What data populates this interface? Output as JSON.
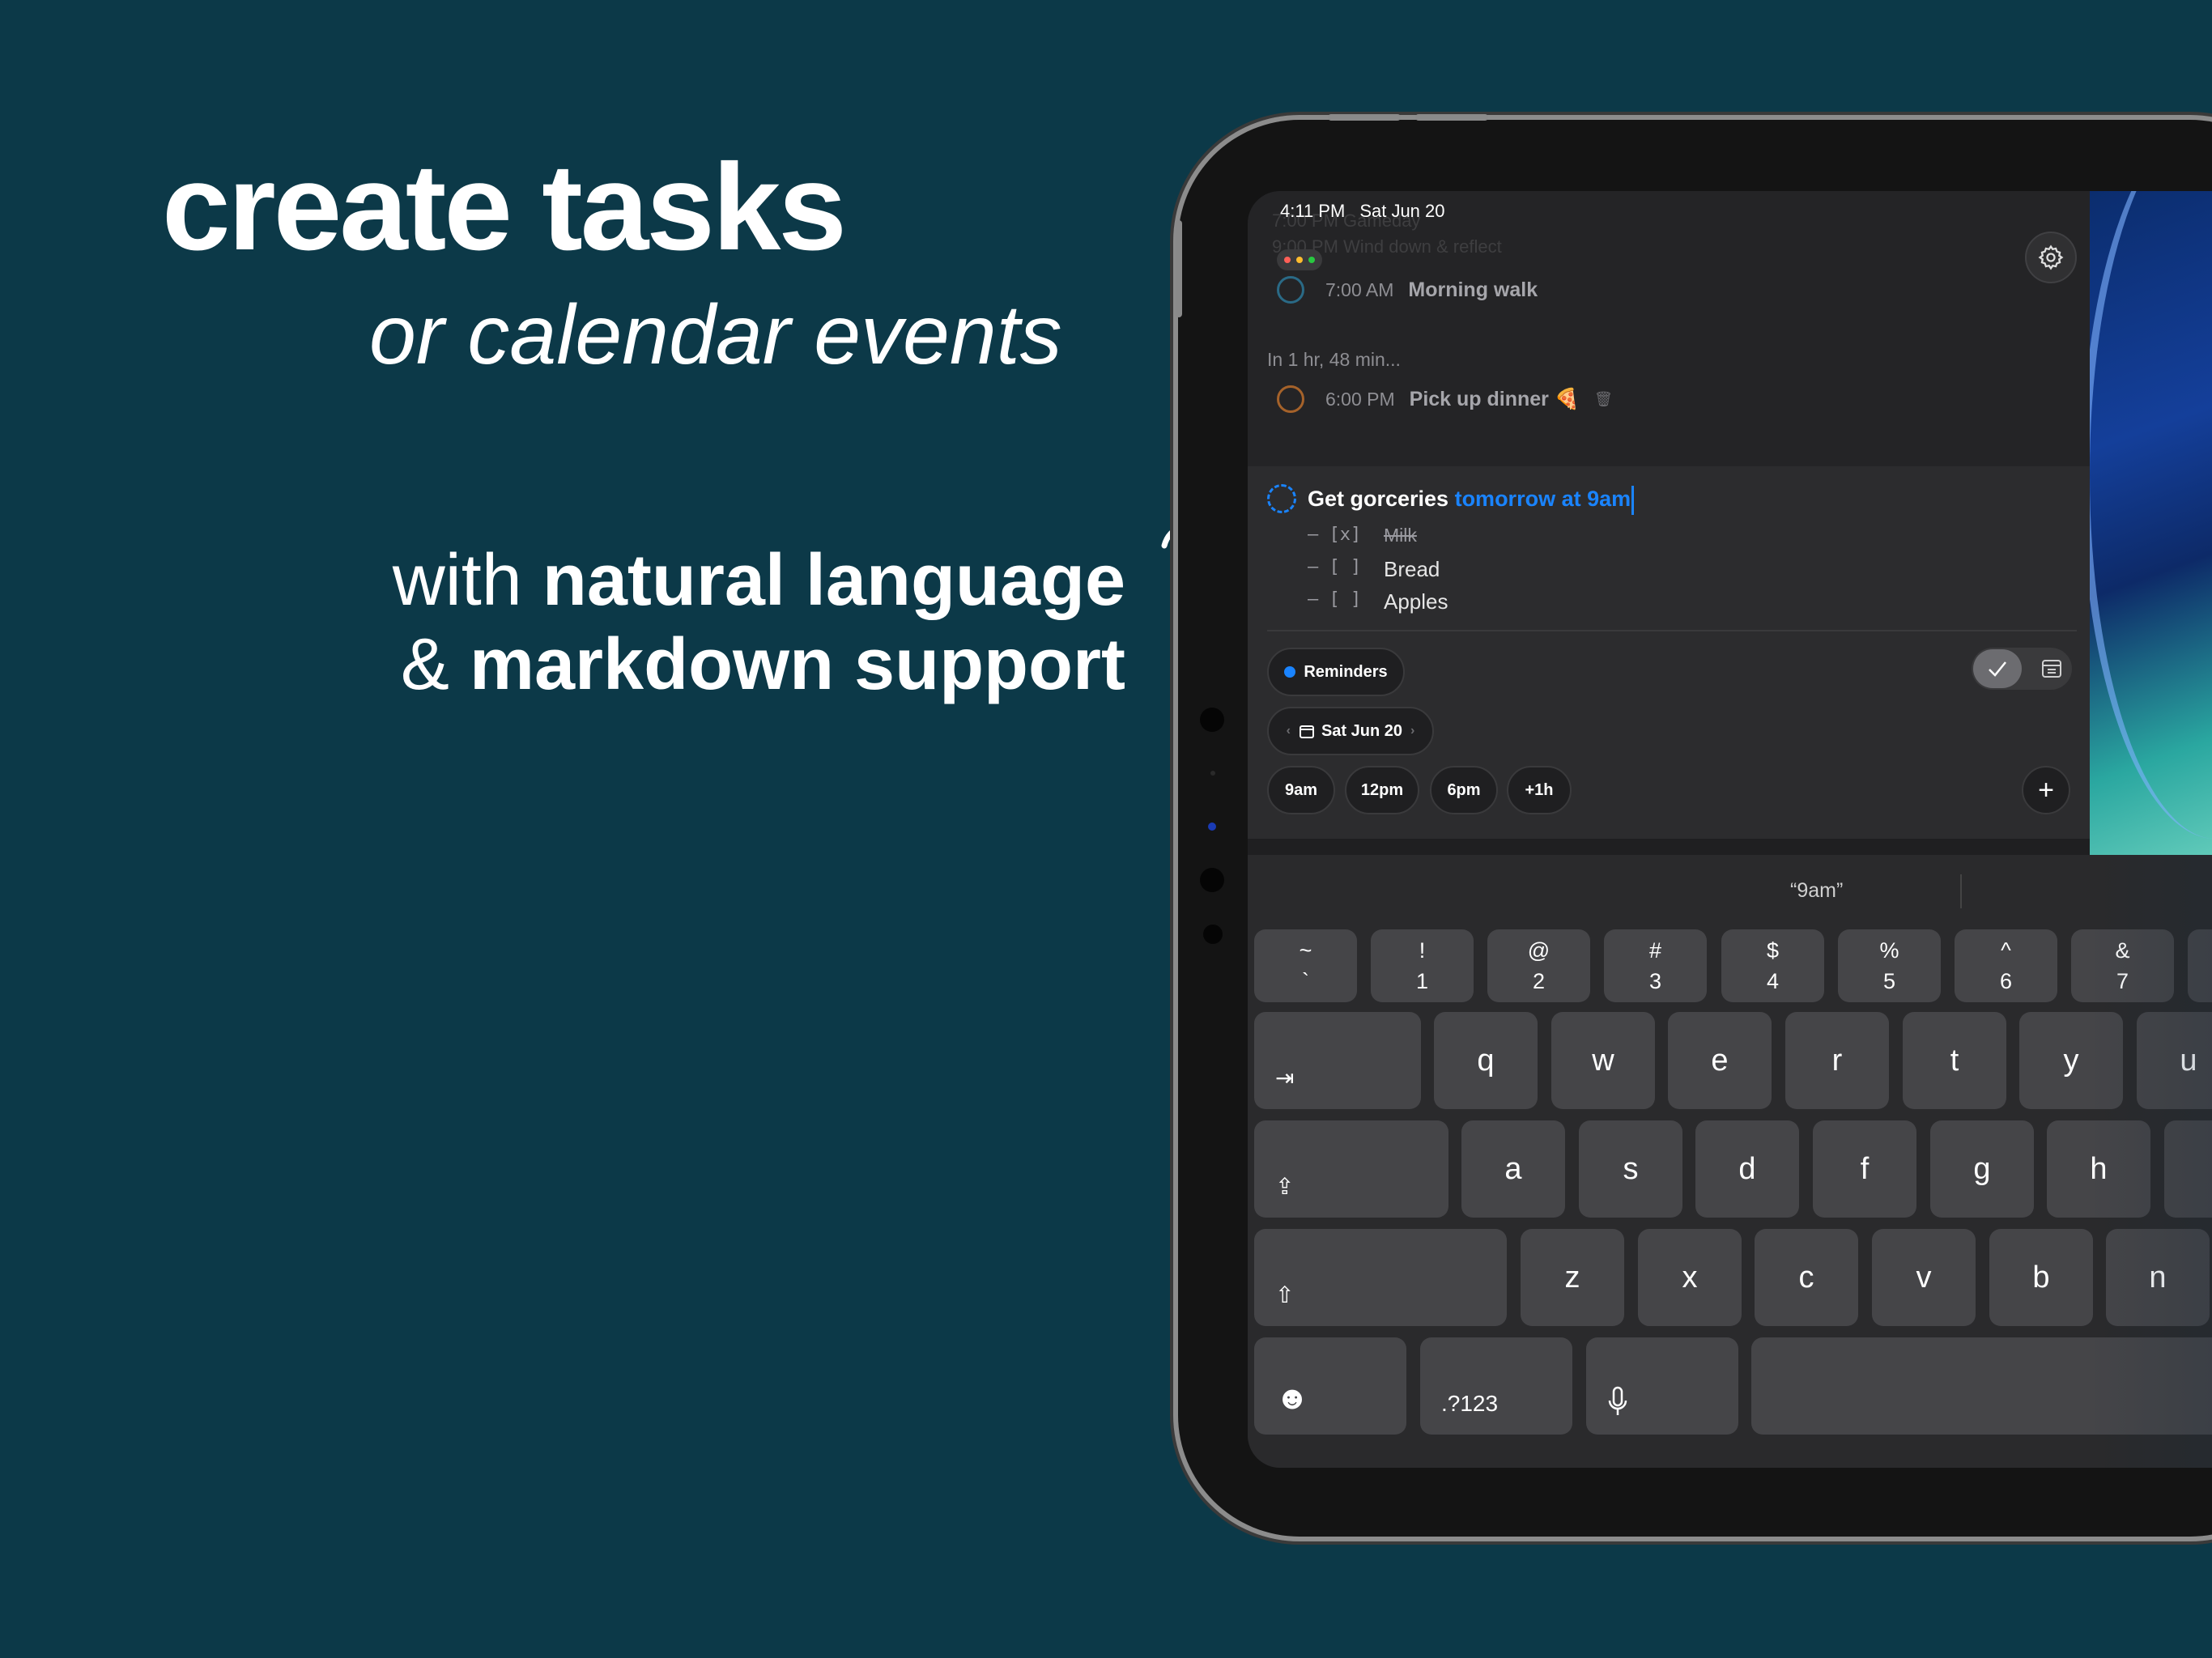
{
  "hero": {
    "headline": "create tasks",
    "subheadline": "or calendar events",
    "feature_line1_prefix": "with ",
    "feature_line1_bold": "natural language",
    "feature_line2_prefix": "& ",
    "feature_line2_bold": "markdown support"
  },
  "status_bar": {
    "time": "4:11 PM",
    "date": "Sat Jun 20"
  },
  "faded_list": {
    "row1": "7:00 PM  Gameday",
    "row2": "9:00 PM  Wind down & reflect"
  },
  "tasks": [
    {
      "time": "7:00 AM",
      "name": "Morning walk",
      "ring_color": "#2a6a86"
    },
    {
      "time": "6:00 PM",
      "name": "Pick up dinner 🍕",
      "ring_color": "#a5622a"
    }
  ],
  "countdown": "In 1 hr, 48 min...",
  "editor": {
    "title_plain": "Get gorceries ",
    "title_detected": "tomorrow at 9am",
    "checklist": [
      {
        "marker": "– [x]",
        "text": "Milk",
        "done": true
      },
      {
        "marker": "– [ ]",
        "text": "Bread",
        "done": false
      },
      {
        "marker": "– [ ]",
        "text": "Apples",
        "done": false
      }
    ],
    "list_pill": "Reminders",
    "date_pill": "Sat Jun 20",
    "quick_times": [
      "9am",
      "12pm",
      "6pm",
      "+1h"
    ],
    "add_label": "+"
  },
  "keyboard": {
    "suggestion": "“9am”",
    "number_row": [
      {
        "top": "~",
        "bottom": "`"
      },
      {
        "top": "!",
        "bottom": "1"
      },
      {
        "top": "@",
        "bottom": "2"
      },
      {
        "top": "#",
        "bottom": "3"
      },
      {
        "top": "$",
        "bottom": "4"
      },
      {
        "top": "%",
        "bottom": "5"
      },
      {
        "top": "^",
        "bottom": "6"
      },
      {
        "top": "&",
        "bottom": "7"
      }
    ],
    "row_q": [
      "q",
      "w",
      "e",
      "r",
      "t",
      "y",
      "u"
    ],
    "row_a": [
      "a",
      "s",
      "d",
      "f",
      "g",
      "h"
    ],
    "row_z": [
      "z",
      "x",
      "c",
      "v",
      "b",
      "n"
    ],
    "tab_icon": "⇥",
    "caps_icon": "⇪",
    "shift_icon": "⇧",
    "emoji_icon": "☻",
    "numbers_label": ".?123"
  },
  "colors": {
    "background": "#0c3948",
    "accent_blue": "#1a84ff"
  }
}
